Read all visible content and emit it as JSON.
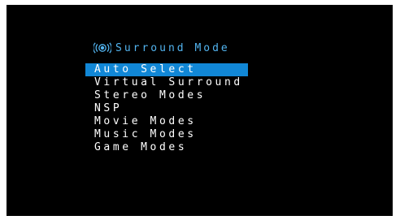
{
  "menu": {
    "title": "Surround Mode",
    "title_icon": "surround-sound-icon",
    "selected_index": 0,
    "items": [
      {
        "label": "Auto Select"
      },
      {
        "label": "Virtual Surround"
      },
      {
        "label": "Stereo Modes"
      },
      {
        "label": "NSP"
      },
      {
        "label": "Movie Modes"
      },
      {
        "label": "Music Modes"
      },
      {
        "label": "Game Modes"
      }
    ]
  },
  "colors": {
    "background": "#000000",
    "title": "#52b4f0",
    "highlight": "#1187d6",
    "text": "#ffffff"
  }
}
